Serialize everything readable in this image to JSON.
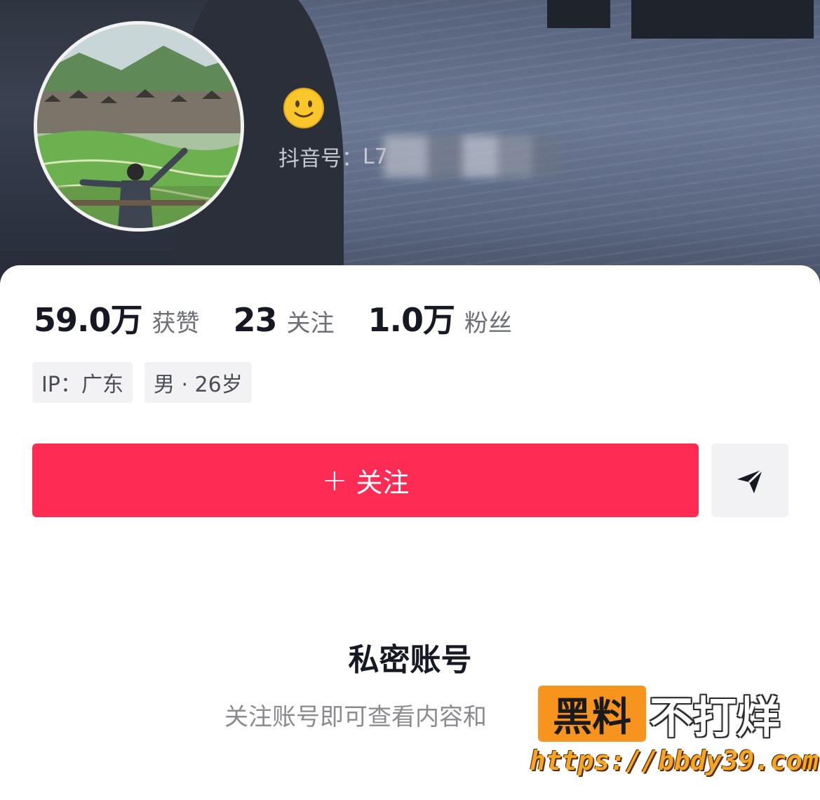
{
  "header": {
    "douyin_id_label": "抖音号：",
    "douyin_id_value": "L7",
    "badge_icon": "slightly-smiling-face-icon"
  },
  "stats": [
    {
      "value": "59.0万",
      "label": "获赞"
    },
    {
      "value": "23",
      "label": "关注"
    },
    {
      "value": "1.0万",
      "label": "粉丝"
    }
  ],
  "tags": [
    "IP：广东",
    "男 · 26岁"
  ],
  "actions": {
    "follow_plus": "+",
    "follow_label": "关注",
    "share_icon": "send-icon"
  },
  "private": {
    "title": "私密账号",
    "subtitle": "关注账号即可查看内容和"
  },
  "watermark": {
    "box_text": "黑料",
    "text": "不打烊",
    "url": "https://bbdy39.com"
  },
  "colors": {
    "accent": "#fe2c55",
    "watermark_orange": "#f7941d"
  }
}
